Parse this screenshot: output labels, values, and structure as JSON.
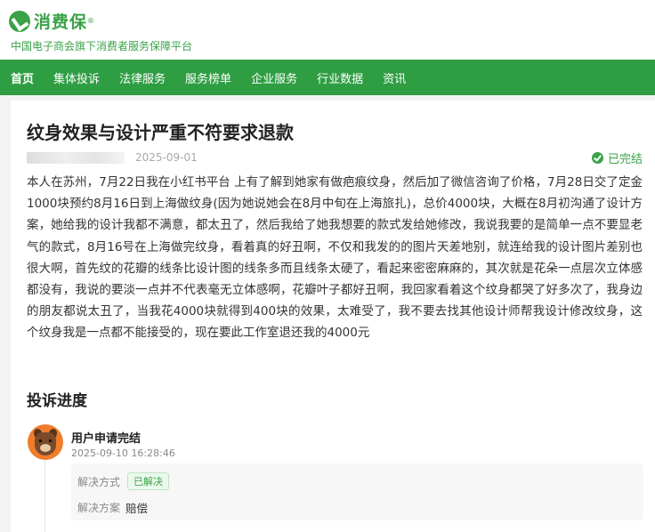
{
  "header": {
    "logo_text": "消费保",
    "tagline": "中国电子商会旗下消费者服务保障平台"
  },
  "nav": {
    "items": [
      {
        "label": "首页",
        "active": true
      },
      {
        "label": "集体投诉"
      },
      {
        "label": "法律服务"
      },
      {
        "label": "服务榜单"
      },
      {
        "label": "企业服务"
      },
      {
        "label": "行业数据"
      },
      {
        "label": "资讯"
      }
    ]
  },
  "complaint": {
    "title": "纹身效果与设计严重不符要求退款",
    "date": "2025-09-01",
    "status": "已完结",
    "body": "本人在苏州，7月22日我在小红书平台 上有了解到她家有做疤痕纹身，然后加了微信咨询了价格，7月28日交了定金1000块预约8月16日到上海做纹身(因为她说她会在8月中旬在上海旅扎)，总价4000块，大概在8月初沟通了设计方案，她给我的设计我都不满意，都太丑了，然后我给了她我想要的款式发给她修改，我说我要的是简单一点不要显老气的款式，8月16号在上海做完纹身，看着真的好丑啊，不仅和我发的的图片天差地别，就连给我的设计图片差别也很大啊，首先纹的花瓣的线条比设计图的线条多而且线条太硬了，看起来密密麻麻的，其次就是花朵一点层次立体感都没有，我说的要淡一点并不代表毫无立体感啊，花瓣叶子都好丑啊，我回家看着这个纹身都哭了好多次了，我身边的朋友都说太丑了，当我花4000块就得到400块的效果，太难受了，我不要去找其他设计师帮我设计修改纹身，这个纹身我是一点都不能接受的，现在要此工作室退还我的4000元"
  },
  "progress": {
    "title": "投诉进度",
    "event": {
      "title": "用户申请完结",
      "time": "2025-09-10 16:28:46",
      "method_label": "解决方式",
      "method_value": "已解决",
      "plan_label": "解决方案",
      "plan_value": "赔偿"
    }
  }
}
